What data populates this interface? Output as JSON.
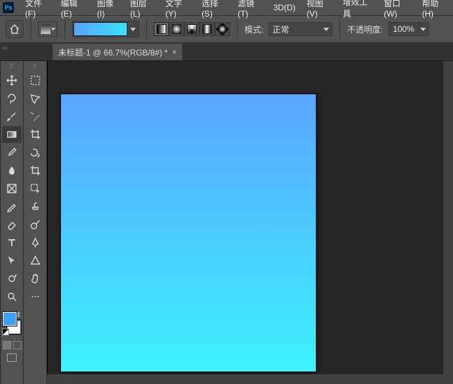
{
  "app": {
    "logo_text": "Ps"
  },
  "menu": {
    "items": [
      "文件(F)",
      "编辑(E)",
      "图像(I)",
      "图层(L)",
      "文字(Y)",
      "选择(S)",
      "滤镜(T)",
      "3D(D)",
      "视图(V)",
      "增效工具",
      "窗口(W)",
      "帮助(H)"
    ]
  },
  "options": {
    "mode_label": "模式:",
    "mode_value": "正常",
    "opacity_label": "不透明度:",
    "opacity_value": "100%",
    "gradient_colors": {
      "start": "#5aa4ff",
      "end": "#36e2ff"
    }
  },
  "tabs": {
    "active": {
      "title": "未标题-1 @ 66.7%(RGB/8#) *",
      "close": "×"
    }
  },
  "tools_left": [
    "move-tool",
    "artboard-tool",
    "lasso-tool",
    "polygon-lasso-tool",
    "brush-tool",
    "magic-wand-tool",
    "gradient-tool",
    "crop-plus-tool",
    "eyedropper-tool",
    "patch-tool",
    "blur-tool",
    "crop-tool",
    "frame-tool",
    "object-select-tool",
    "pencil-tool",
    "clone-stamp-tool",
    "eraser-tool",
    "dodge-tool",
    "type-tool",
    "pen-tool",
    "path-select-tool",
    "shape-tool",
    "rotate-view-tool",
    "hand-tool",
    "zoom-tool",
    "ellipsis-tool"
  ],
  "colors": {
    "foreground": "#3aa1ff",
    "background": "#ffffff"
  },
  "canvas": {
    "gradient_top": "#5aa4ff",
    "gradient_bottom": "#3df2fd"
  }
}
